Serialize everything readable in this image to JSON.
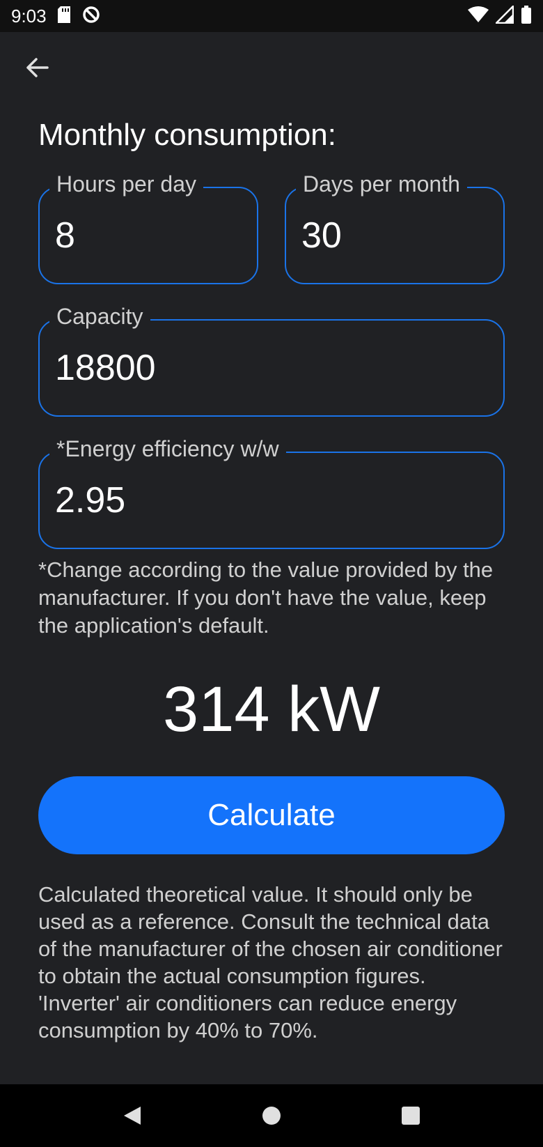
{
  "status_bar": {
    "time": "9:03",
    "icons": [
      "sd-card-icon",
      "sync-icon",
      "wifi-icon",
      "signal-icon",
      "battery-icon"
    ]
  },
  "toolbar": {
    "back_icon": "arrow-back-icon"
  },
  "form": {
    "heading": "Monthly consumption:",
    "hours_per_day": {
      "label": "Hours per day",
      "value": "8"
    },
    "days_per_month": {
      "label": "Days per month",
      "value": "30"
    },
    "capacity": {
      "label": "Capacity",
      "value": "18800"
    },
    "energy_efficiency": {
      "label": "*Energy efficiency w/w",
      "value": "2.95"
    },
    "note": "*Change according to the value provided by the manufacturer. If you don't have the value, keep the application's default."
  },
  "result": {
    "text": "314 kW"
  },
  "calculate_button": {
    "label": "Calculate"
  },
  "disclaimer": "Calculated theoretical value. It should only be used as a reference. Consult the technical data of the manufacturer of the chosen air conditioner to obtain the actual consumption figures. 'Inverter' air conditioners can reduce energy consumption by 40% to 70%.",
  "colors": {
    "background": "#202124",
    "accent": "#1a73e8",
    "button": "#1473fb"
  },
  "nav_bar": {
    "icons": [
      "back-triangle-icon",
      "home-circle-icon",
      "recents-square-icon"
    ]
  }
}
